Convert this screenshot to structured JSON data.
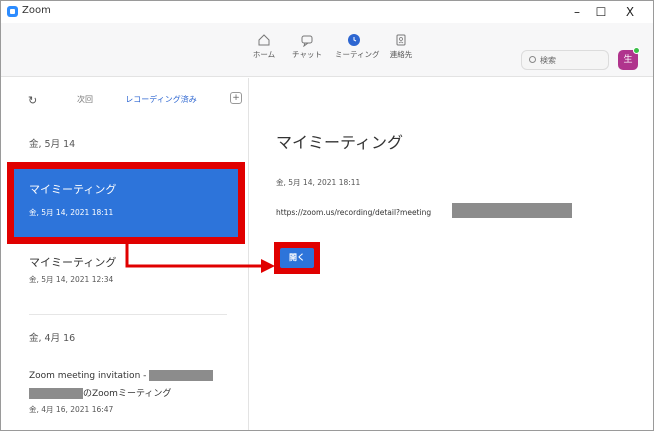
{
  "window": {
    "title": "Zoom",
    "minimize": "–",
    "maximize": "☐",
    "close": "X"
  },
  "nav": {
    "home": "ホーム",
    "chat": "チャット",
    "meetings": "ミーティング",
    "contacts": "連絡先"
  },
  "search": {
    "placeholder": "検索"
  },
  "avatar": {
    "initial": "生"
  },
  "left": {
    "refresh_icon": "↻",
    "tab_upcoming": "次回",
    "tab_recorded": "レコーディング済み",
    "add_icon": "+",
    "date_group_1": "金, 5月 14",
    "date_group_2": "金, 4月 16",
    "items": [
      {
        "title": "マイミーティング",
        "date": "金, 5月 14, 2021 18:11"
      },
      {
        "title": "マイミーティング",
        "date": "金, 5月 14, 2021 12:34"
      },
      {
        "title_prefix": "Zoom meeting invitation -",
        "title_suffix": "のZoomミーティング",
        "date": "金, 4月 16, 2021 16:47"
      }
    ]
  },
  "detail": {
    "title": "マイミーティング",
    "date": "金, 5月 14, 2021 18:11",
    "url": "https://zoom.us/recording/detail?meeting",
    "open_button": "開く"
  },
  "colors": {
    "accent": "#2d74da",
    "highlight": "#e00000",
    "brand": "#2d8cff"
  }
}
